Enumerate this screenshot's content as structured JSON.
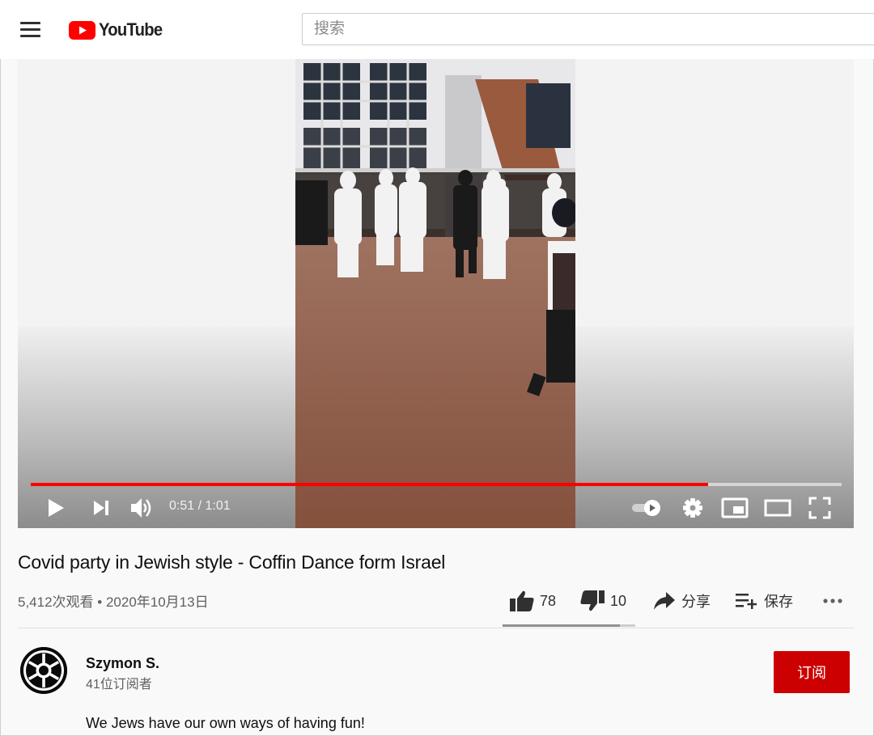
{
  "header": {
    "brand": "YouTube",
    "search_placeholder": "搜索"
  },
  "player": {
    "progress": 0.835,
    "time_current": "0:51",
    "time_separator": " / ",
    "time_total": "1:01"
  },
  "video": {
    "title": "Covid party in Jewish style - Coffin Dance form Israel",
    "views": "5,412次观看",
    "meta_separator": " • ",
    "date": "2020年10月13日"
  },
  "actions": {
    "likes": "78",
    "dislikes": "10",
    "share_label": "分享",
    "save_label": "保存",
    "like_ratio": 0.886
  },
  "channel": {
    "name": "Szymon S.",
    "subscribers": "41位订阅者",
    "subscribe_label": "订阅"
  },
  "description": {
    "text": "We Jews have our own ways of having fun!"
  },
  "colors": {
    "brand_red": "#ff0000",
    "subscribe_red": "#cc0000"
  }
}
